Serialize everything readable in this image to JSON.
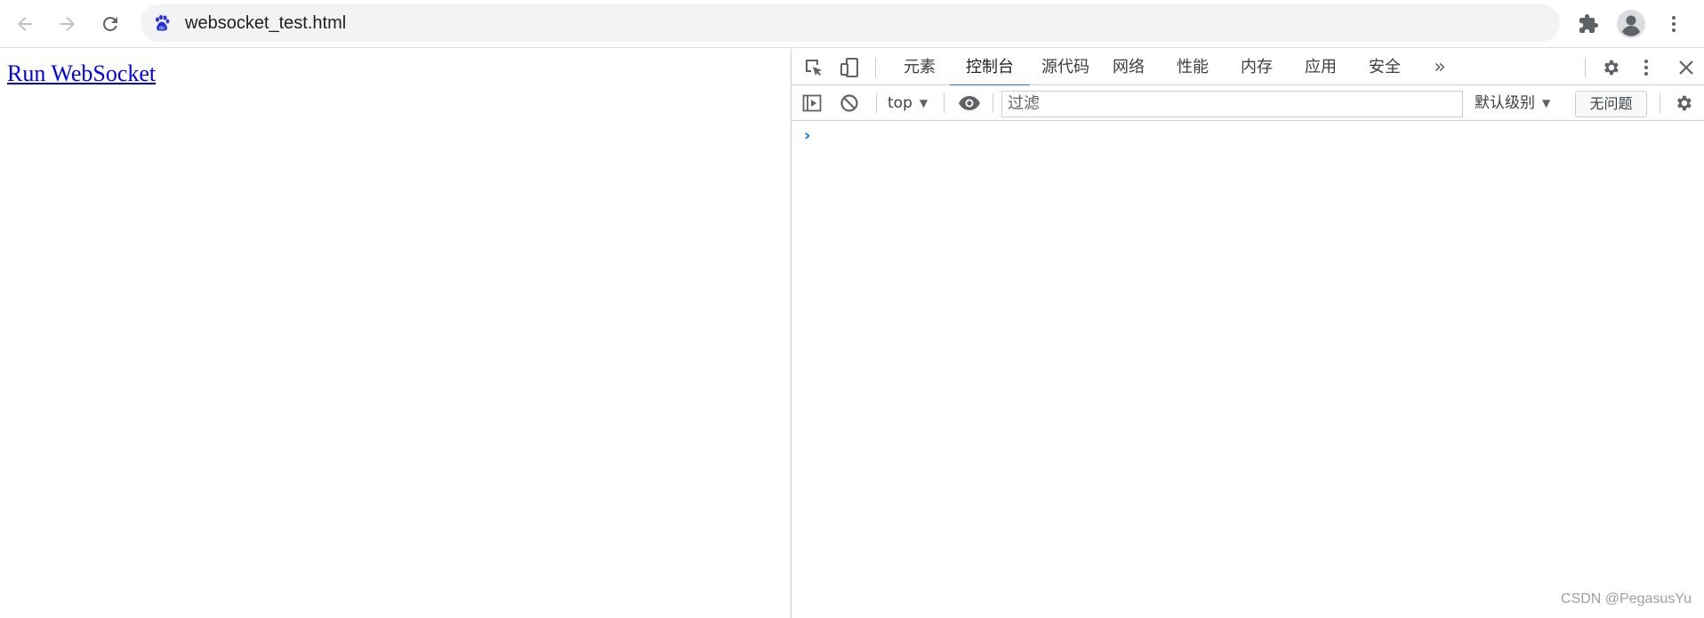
{
  "browser": {
    "url": "websocket_test.html",
    "back_icon": "arrow-left-icon",
    "forward_icon": "arrow-right-icon",
    "reload_icon": "reload-icon",
    "extensions_icon": "puzzle-icon",
    "profile_icon": "avatar-icon",
    "menu_icon": "kebab-menu-icon"
  },
  "page": {
    "link_text": "Run WebSocket"
  },
  "devtools": {
    "tabs": [
      {
        "label": "元素"
      },
      {
        "label": "控制台"
      },
      {
        "label": "源代码"
      },
      {
        "label": "网络"
      },
      {
        "label": "性能"
      },
      {
        "label": "内存"
      },
      {
        "label": "应用"
      },
      {
        "label": "安全"
      }
    ],
    "active_tab": "控制台",
    "more_tabs": "»",
    "context": "top",
    "filter_placeholder": "过滤",
    "level": "默认级别",
    "issues_label": "无问题",
    "prompt": "›",
    "accent": "#1a73e8"
  },
  "watermark": "CSDN @PegasusYu"
}
